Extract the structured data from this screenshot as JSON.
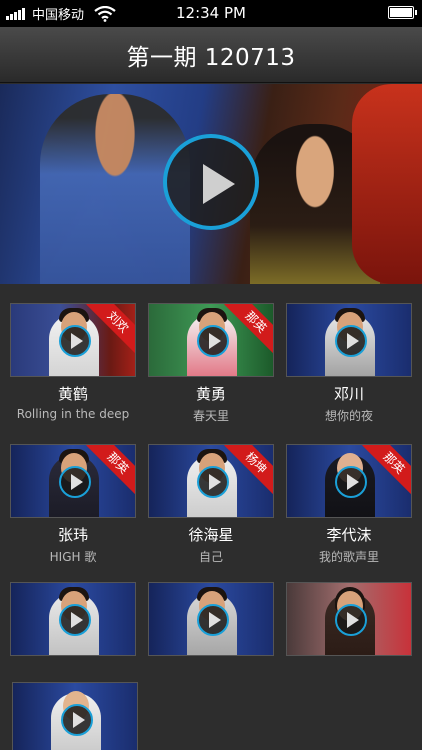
{
  "status_bar": {
    "carrier": "中国移动",
    "time": "12:34 PM"
  },
  "header": {
    "title": "第一期 120713"
  },
  "hero": {
    "play_icon": "play-icon"
  },
  "videos": [
    {
      "name": "黄鹤",
      "song": "Rolling in the deep",
      "ribbon": "刘欢"
    },
    {
      "name": "黄勇",
      "song": "春天里",
      "ribbon": "那英"
    },
    {
      "name": "邓川",
      "song": "想你的夜",
      "ribbon": ""
    },
    {
      "name": "张玮",
      "song": "HIGH 歌",
      "ribbon": "那英"
    },
    {
      "name": "徐海星",
      "song": "自己",
      "ribbon": "杨坤"
    },
    {
      "name": "李代沫",
      "song": "我的歌声里",
      "ribbon": "那英"
    },
    {
      "name": "",
      "song": "",
      "ribbon": ""
    },
    {
      "name": "",
      "song": "",
      "ribbon": ""
    },
    {
      "name": "",
      "song": "",
      "ribbon": ""
    },
    {
      "name": "",
      "song": "",
      "ribbon": ""
    }
  ],
  "colors": {
    "accent": "#1aa0d8",
    "ribbon": "#d21b1b"
  }
}
